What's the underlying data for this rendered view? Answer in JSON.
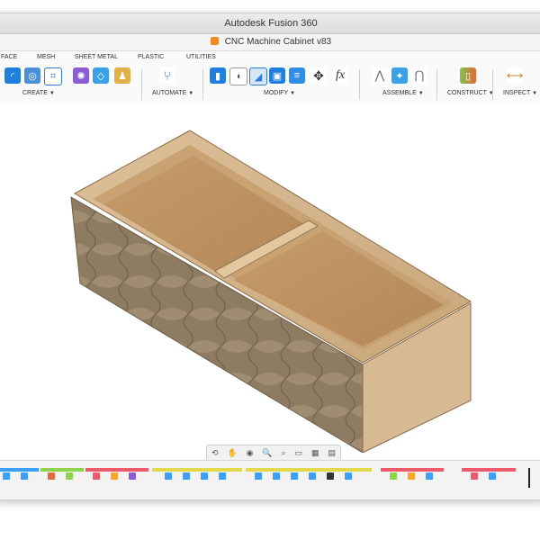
{
  "app": {
    "title": "Autodesk Fusion 360",
    "document": "CNC Machine Cabinet v83"
  },
  "tabs": [
    "FACE",
    "MESH",
    "SHEET METAL",
    "PLASTIC",
    "UTILITIES"
  ],
  "groups": {
    "create": "CREATE",
    "automate": "AUTOMATE",
    "modify": "MODIFY",
    "assemble": "ASSEMBLE",
    "construct": "CONSTRUCT",
    "inspect": "INSPECT"
  },
  "tools": {
    "fx": "fx"
  },
  "colors": {
    "accent_blue": "#1f7fe0",
    "wood_light": "#d8b890",
    "wood_dark": "#a9865e",
    "carved_wood": "#8b7a62"
  },
  "navbar_icons": [
    "orbit-icon",
    "pan-icon",
    "look-at-icon",
    "zoom-icon",
    "fit-icon",
    "display-settings-icon",
    "grid-icon",
    "viewports-icon"
  ],
  "timeline_segments": [
    "#3aa0ff",
    "#e3d94a",
    "#8dd34c",
    "#ef5a6a",
    "#ffa42a",
    "#3aa0ff",
    "#8dd34c",
    "#e3d94a"
  ]
}
